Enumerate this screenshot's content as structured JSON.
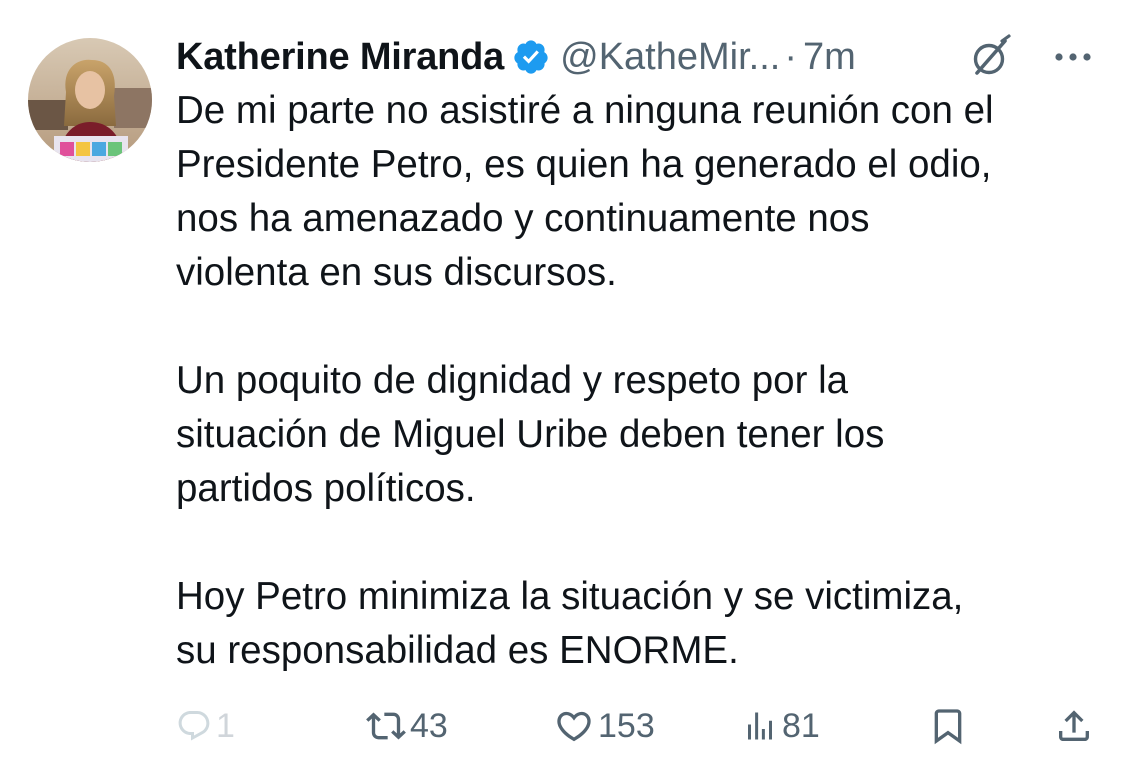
{
  "author": {
    "display_name": "Katherine Miranda",
    "handle": "@KatheMir...",
    "time_separator": "·",
    "timestamp": "7m",
    "verified_icon": "verified-badge-icon",
    "verified_color": "#1d9bf0"
  },
  "tweet": {
    "text": "De mi parte no asistiré a ninguna reunión con el\nPresidente Petro, es quien ha generado el odio,\nnos ha amenazado y continuamente nos\nviolenta en sus discursos.\n\nUn poquito de dignidad y respeto por la\nsituación de Miguel Uribe deben tener los\npartidos políticos.\n\nHoy Petro minimiza la situación y se victimiza,\nsu responsabilidad es ENORME."
  },
  "actions": {
    "replies": "1",
    "reposts": "43",
    "likes": "153",
    "views": "81",
    "icons": [
      "reply-icon",
      "repost-icon",
      "like-icon",
      "views-icon",
      "bookmark-icon",
      "share-icon"
    ]
  },
  "colors": {
    "text": "#0f1419",
    "secondary": "#536471",
    "muted": "#cfd9de",
    "accent": "#1d9bf0"
  }
}
